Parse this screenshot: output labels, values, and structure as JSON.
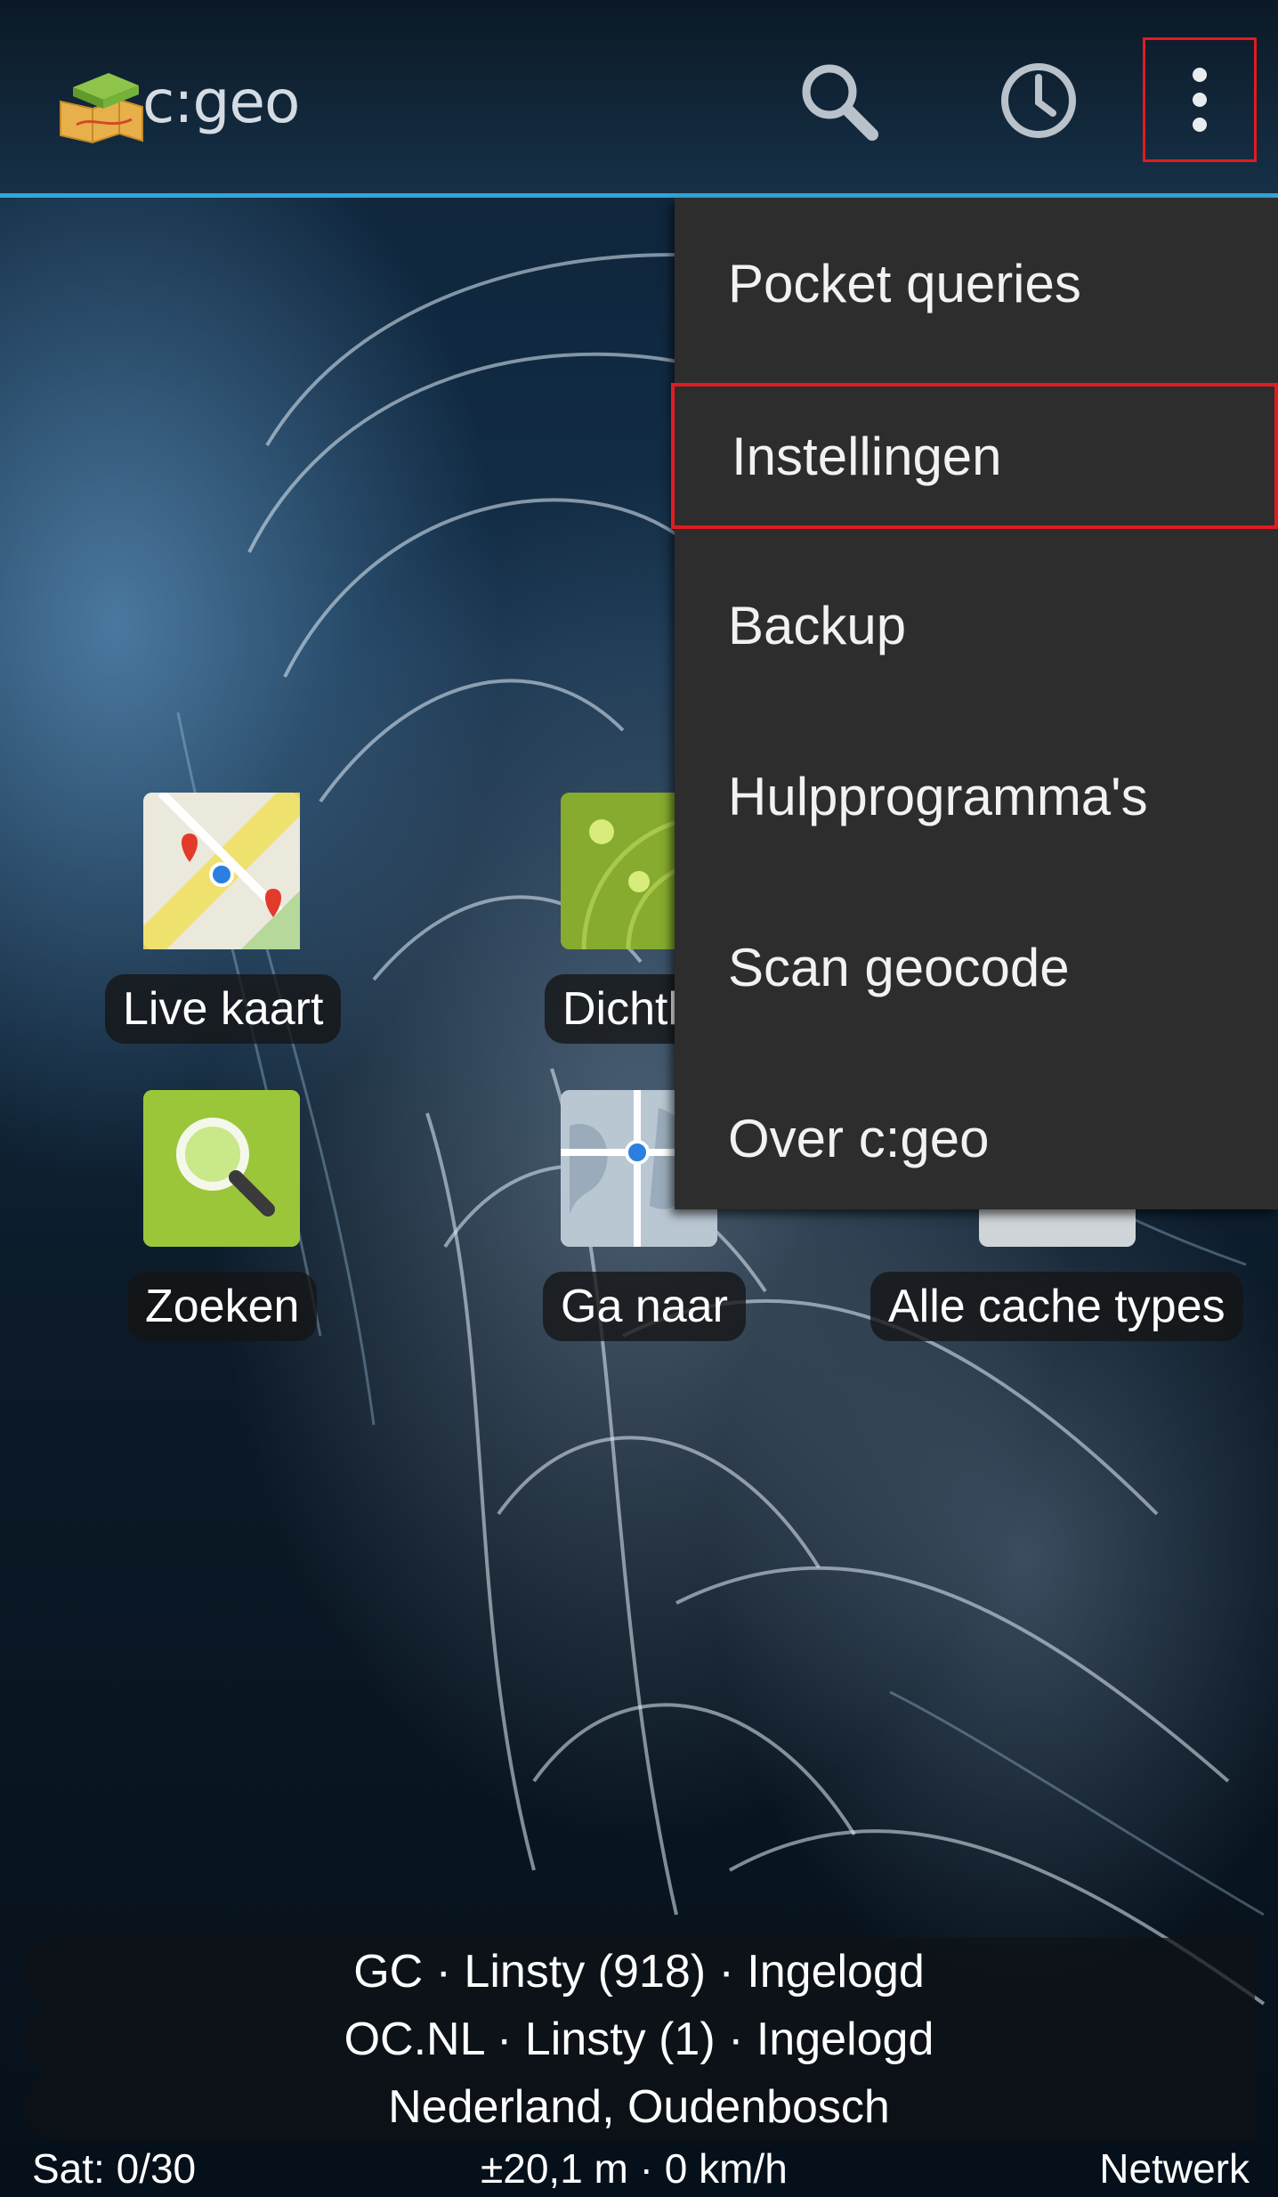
{
  "app": {
    "title": "c:geo"
  },
  "actionbar": {
    "search_icon": "search-icon",
    "history_icon": "history-icon",
    "overflow_icon": "overflow-menu-icon"
  },
  "menu": {
    "items": [
      {
        "label": "Pocket queries"
      },
      {
        "label": "Instellingen"
      },
      {
        "label": "Backup"
      },
      {
        "label": "Hulpprogramma's"
      },
      {
        "label": "Scan geocode"
      },
      {
        "label": "Over c:geo"
      }
    ]
  },
  "tiles": [
    {
      "label": "Live kaart",
      "icon": "map-icon"
    },
    {
      "label": "Dichtbij",
      "icon": "radar-icon"
    },
    {
      "label": "Zoeken",
      "icon": "search-icon"
    },
    {
      "label": "Ga naar",
      "icon": "globe-map-icon"
    },
    {
      "label": "Alle cache types",
      "icon": "cache-types-icon"
    }
  ],
  "status": {
    "gc": "GC · Linsty (918) · Ingelogd",
    "oc": "OC.NL · Linsty (1) · Ingelogd",
    "location": "Nederland, Oudenbosch"
  },
  "footer": {
    "sat": "Sat: 0/30",
    "accuracy": "±20,1 m · 0 km/h",
    "provider": "Netwerk"
  },
  "colors": {
    "accent": "#33a6d9",
    "highlight": "#e01b22",
    "menu_bg": "#2d2d2d"
  }
}
